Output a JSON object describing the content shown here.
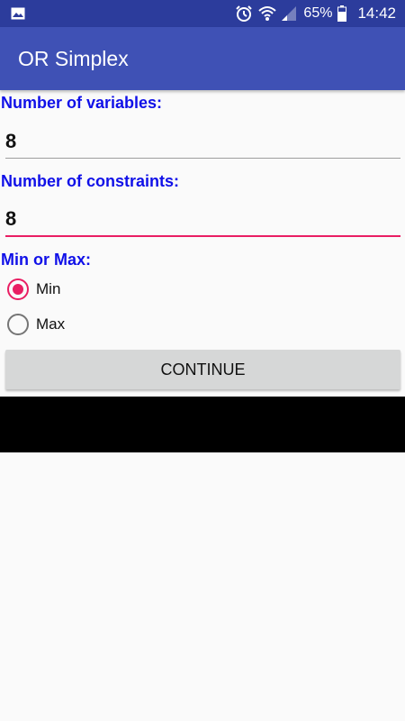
{
  "status_bar": {
    "left_icon": "image-icon",
    "alarm_icon": "alarm-clock-icon",
    "wifi_icon": "wifi-icon",
    "signal_icon": "cell-signal-icon",
    "battery_percent": "65%",
    "battery_icon": "battery-icon",
    "time": "14:42"
  },
  "app_bar": {
    "title": "OR Simplex"
  },
  "form": {
    "variables_label": "Number of variables:",
    "variables_value": "8",
    "constraints_label": "Number of constraints:",
    "constraints_value": "8",
    "min_max_label": "Min or Max:",
    "options": [
      {
        "label": "Min",
        "selected": true
      },
      {
        "label": "Max",
        "selected": false
      }
    ],
    "continue_label": "CONTINUE"
  },
  "colors": {
    "status_bar": "#2c3c9c",
    "app_bar": "#3f51b5",
    "label_text": "#1010e8",
    "accent": "#e91e63",
    "button_bg": "#d6d7d7"
  }
}
